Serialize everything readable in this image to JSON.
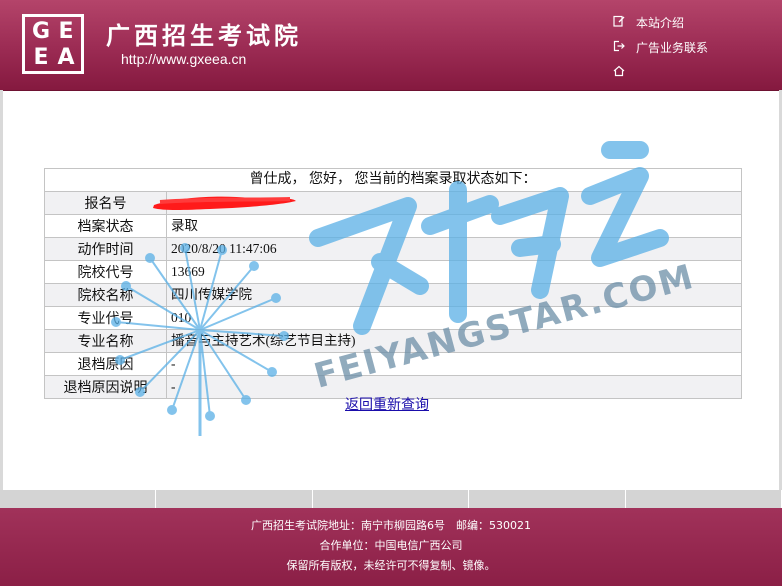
{
  "header": {
    "logo_letters": [
      "G",
      "E",
      "E",
      "A"
    ],
    "title": "广西招生考试院",
    "url": "http://www.gxeea.cn",
    "links": [
      {
        "label": "本站介绍",
        "icon": "document-edit-icon"
      },
      {
        "label": "广告业务联系",
        "icon": "logout-arrow-icon"
      },
      {
        "label": "",
        "icon": "home-icon"
      }
    ]
  },
  "result": {
    "greeting": "曾仕成， 您好， 您当前的档案录取状态如下：",
    "rows": [
      {
        "label": "报名号",
        "value": ""
      },
      {
        "label": "档案状态",
        "value": "录取"
      },
      {
        "label": "动作时间",
        "value": "2020/8/20 11:47:06"
      },
      {
        "label": "院校代号",
        "value": "13669"
      },
      {
        "label": "院校名称",
        "value": "四川传媒学院"
      },
      {
        "label": "专业代号",
        "value": "010"
      },
      {
        "label": "专业名称",
        "value": "播音与主持艺术(综艺节目主持)"
      },
      {
        "label": "退档原因",
        "value": "-"
      },
      {
        "label": "退档原因说明",
        "value": "-"
      }
    ],
    "back_link": "返回重新查询"
  },
  "watermark": {
    "brand_cn": "飞扬之星",
    "brand_en": "FEIYANGSTAR.COM",
    "color": "#5ab0e6"
  },
  "footer": {
    "address": "广西招生考试院地址：南宁市柳园路6号　邮编：530021",
    "partner": "合作单位：中国电信广西公司",
    "copyright": "保留所有版权，未经许可不得复制、镜像。"
  },
  "colors": {
    "header": "#9b2b53",
    "footer": "#8b1f46",
    "redaction": "#ff1a1a",
    "link": "#1a0dab"
  }
}
